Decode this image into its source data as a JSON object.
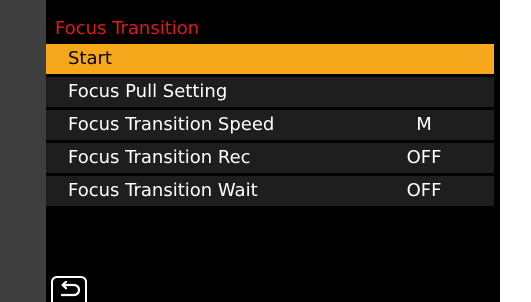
{
  "menu_title": "Focus Transition",
  "items": [
    {
      "label": "Start",
      "value": ""
    },
    {
      "label": "Focus Pull Setting",
      "value": ""
    },
    {
      "label": "Focus Transition Speed",
      "value": "M"
    },
    {
      "label": "Focus Transition Rec",
      "value": "OFF"
    },
    {
      "label": "Focus Transition Wait",
      "value": "OFF"
    }
  ],
  "selected_index": 0,
  "back_icon": "return-arrow-icon",
  "colors": {
    "title": "#e01818",
    "highlight": "#f6a81c",
    "row": "#1e1e1e",
    "sidebar": "#3e3e3e"
  }
}
